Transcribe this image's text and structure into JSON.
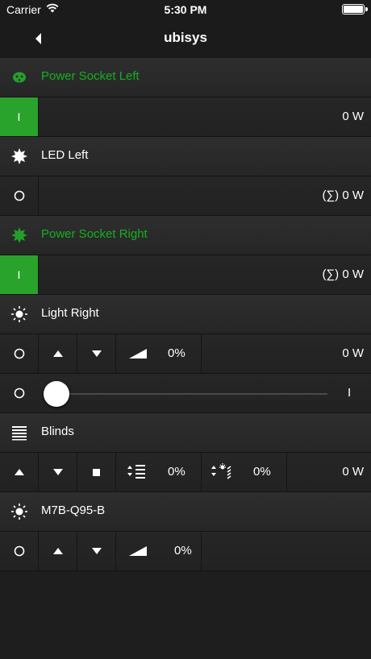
{
  "status": {
    "carrier": "Carrier",
    "time": "5:30 PM"
  },
  "nav": {
    "title": "ubisys"
  },
  "devices": {
    "socket_left": {
      "name": "Power Socket Left",
      "on_symbol": "I",
      "power": "0 W"
    },
    "led_left": {
      "name": "LED Left",
      "off_symbol": "O",
      "power": "(∑) 0 W"
    },
    "socket_right": {
      "name": "Power Socket Right",
      "on_symbol": "I",
      "power": "(∑) 0 W"
    },
    "light_right": {
      "name": "Light Right",
      "off_symbol": "O",
      "level_text": "0%",
      "power": "0 W",
      "slider_min": "O",
      "slider_max": "I",
      "slider_level": 0
    },
    "blinds": {
      "name": "Blinds",
      "lift_text": "0%",
      "tilt_text": "0%",
      "power": "0 W"
    },
    "m7b": {
      "name": "M7B-Q95-B",
      "off_symbol": "O",
      "level_text": "0%"
    }
  },
  "colors": {
    "accent_green": "#29a32c",
    "label_green": "#22a12a",
    "background": "#1e1e1e"
  },
  "icons": [
    "wifi-icon",
    "battery-icon",
    "back-chevron-icon",
    "socket-icon",
    "burst-icon",
    "sun-icon",
    "blinds-icon",
    "up-arrow-icon",
    "down-arrow-icon",
    "stop-icon",
    "ramp-icon",
    "lift-icon",
    "tilt-icon"
  ]
}
